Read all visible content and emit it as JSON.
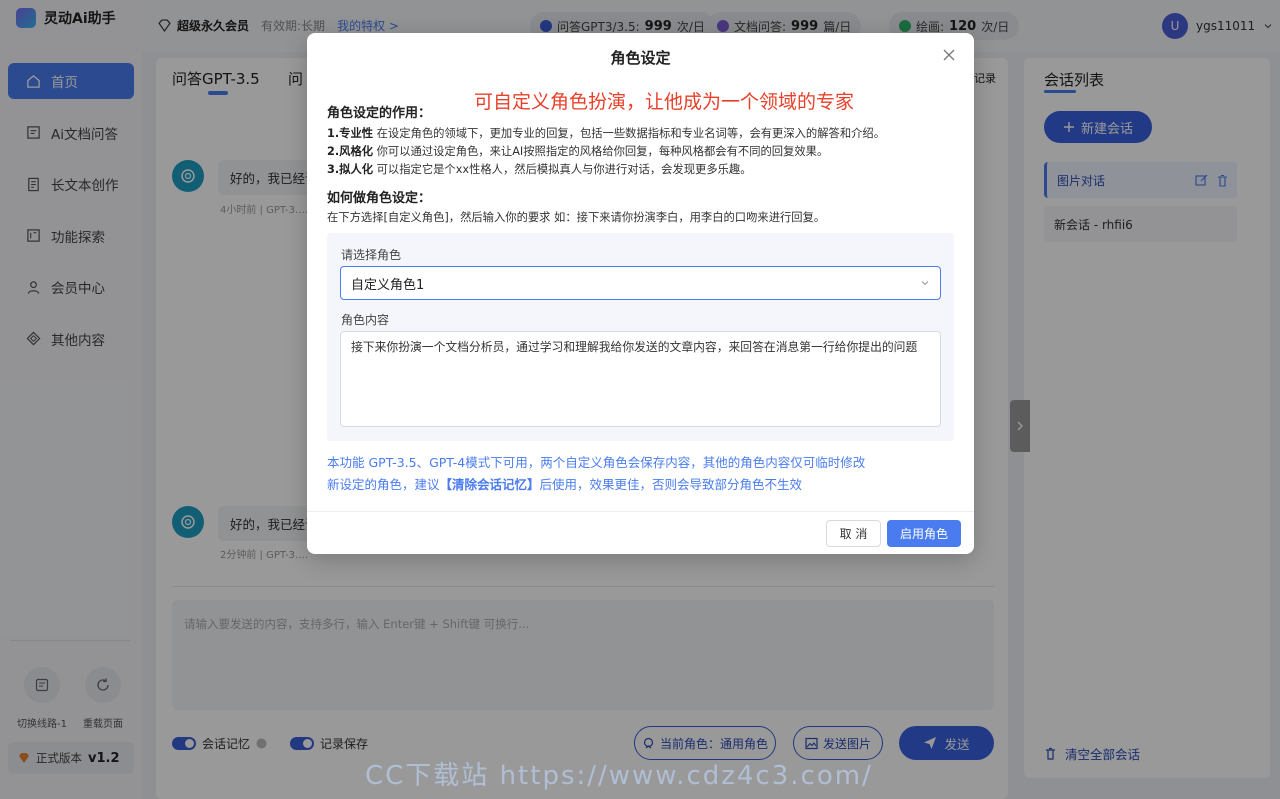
{
  "app": {
    "name": "灵动Ai助手"
  },
  "sidebar": {
    "items": [
      {
        "label": "首页",
        "icon": "home-icon"
      },
      {
        "label": "Ai文档问答",
        "icon": "document-qa-icon"
      },
      {
        "label": "长文本创作",
        "icon": "long-text-icon"
      },
      {
        "label": "功能探索",
        "icon": "explore-icon"
      },
      {
        "label": "会员中心",
        "icon": "user-icon"
      },
      {
        "label": "其他内容",
        "icon": "other-icon"
      }
    ],
    "tools": [
      {
        "label": "切换线路-1",
        "icon": "switch-route-icon"
      },
      {
        "label": "重载页面",
        "icon": "reload-icon"
      }
    ],
    "version_label": "正式版本",
    "version": "v1.2"
  },
  "topbar": {
    "member_title": "超级永久会员",
    "validity": "有效期:长期",
    "privileges_link": "我的特权 >",
    "quotas": [
      {
        "label": "问答GPT3/3.5:",
        "value": "999",
        "unit": "次/日",
        "color": "#3a5ed8"
      },
      {
        "label": "文档问答:",
        "value": "999",
        "unit": "篇/日",
        "color": "#7b5cd6"
      },
      {
        "label": "绘画:",
        "value": "120",
        "unit": "次/日",
        "color": "#2fb36a"
      }
    ],
    "user": {
      "avatar_letter": "U",
      "name": "ygs11011"
    }
  },
  "main": {
    "tabs": [
      "问答GPT-3.5",
      "问"
    ],
    "record_label": "记录",
    "messages": [
      {
        "text": "好的，我已经识",
        "meta": "4小时前  |  GPT-3.…"
      },
      {
        "text": "好的，我已经识",
        "meta": "2分钟前  |  GPT-3.…"
      }
    ],
    "input_placeholder": "请输入要发送的内容，支持多行，输入 Enter键 + Shift键 可换行...",
    "toggles": [
      "会话记忆",
      "记录保存"
    ],
    "current_role_btn": "当前角色：通用角色",
    "send_image_btn": "发送图片",
    "send_btn": "发送"
  },
  "right_panel": {
    "title": "会话列表",
    "new_chat": "新建会话",
    "conversations": [
      "图片对话",
      "新会话 - rhfii6"
    ],
    "clear_all": "清空全部会话"
  },
  "watermark": "CC下载站 https://www.cdz4c3.com/",
  "modal": {
    "title": "角色设定",
    "annotation": "可自定义角色扮演，让他成为一个领域的专家",
    "section1_title": "角色设定的作用：",
    "points": [
      {
        "head": "1.专业性",
        "text": " 在设定角色的领域下，更加专业的回复，包括一些数据指标和专业名词等，会有更深入的解答和介绍。"
      },
      {
        "head": "2.风格化",
        "text": " 你可以通过设定角色，来让AI按照指定的风格给你回复，每种风格都会有不同的回复效果。"
      },
      {
        "head": "3.拟人化",
        "text": " 可以指定它是个xx性格人，然后模拟真人与你进行对话，会发现更多乐趣。"
      }
    ],
    "section2_title": "如何做角色设定：",
    "section2_text": "在下方选择[自定义角色]，然后输入你的要求 如：接下来请你扮演李白，用李白的口吻来进行回复。",
    "select_label": "请选择角色",
    "select_value": "自定义角色1",
    "content_label": "角色内容",
    "content_value": "接下来你扮演一个文档分析员，通过学习和理解我给你发送的文章内容，来回答在消息第一行给你提出的问题",
    "note1": "本功能 GPT-3.5、GPT-4模式下可用，两个自定义角色会保存内容，其他的角色内容仅可临时修改",
    "note2_pre": "新设定的角色，建议",
    "note2_bold": "【清除会话记忆】",
    "note2_post": "后使用，效果更佳，否则会导致部分角色不生效",
    "cancel": "取 消",
    "confirm": "启用角色"
  }
}
